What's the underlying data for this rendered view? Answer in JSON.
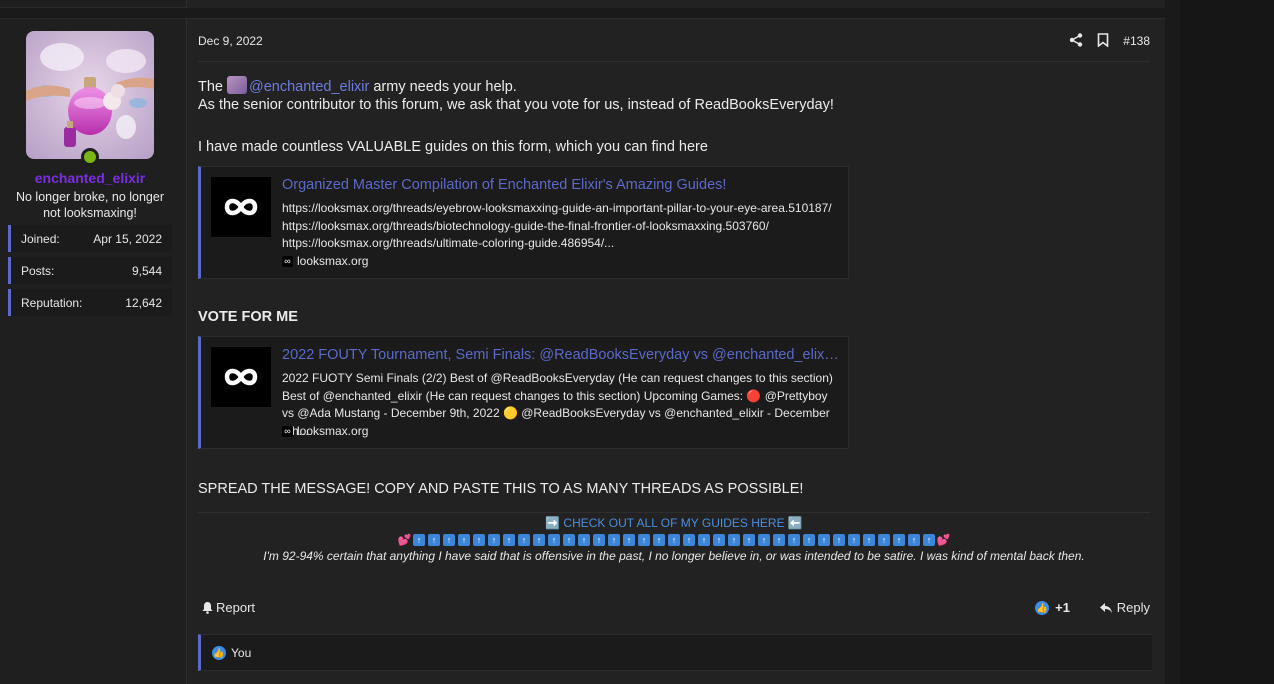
{
  "post": {
    "date": "Dec 9, 2022",
    "number": "#138",
    "author": {
      "username": "enchanted_elixir",
      "user_title": "No longer broke, no longer not looksmaxing!",
      "online": true,
      "stats": [
        {
          "label": "Joined:",
          "value": "Apr 15, 2022"
        },
        {
          "label": "Posts:",
          "value": "9,544"
        },
        {
          "label": "Reputation:",
          "value": "12,642"
        }
      ]
    },
    "lines": {
      "l1_pre": "The ",
      "l1_mention": "@enchanted_elixir",
      "l1_post": " army needs your help.",
      "l2": "As the senior contributor to this forum, we ask that you vote for us, instead of ReadBooksEveryday!",
      "l3": "I have made countless VALUABLE guides on this form, which you can find here",
      "vote": "VOTE FOR ME",
      "spread": "SPREAD THE MESSAGE! COPY AND PASTE THIS TO AS MANY THREADS AS POSSIBLE!"
    },
    "unfurls": [
      {
        "title": "Organized Master Compilation of Enchanted Elixir's Amazing Guides!",
        "description": "https://looksmax.org/threads/eyebrow-looksmaxxing-guide-an-important-pillar-to-your-eye-area.510187/ https://looksmax.org/threads/biotechnology-guide-the-final-frontier-of-looksmaxxing.503760/ https://looksmax.org/threads/ultimate-coloring-guide.486954/...",
        "site": "looksmax.org"
      },
      {
        "title": "2022 FOUTY Tournament, Semi Finals: @ReadBooksEveryday vs @enchanted_elixir...",
        "description": "2022 FUOTY Semi Finals (2/2) Best of @ReadBooksEveryday (He can request changes to this section) Best of @enchanted_elixir (He can request changes to this section) Upcoming Games: 🔴 @Prettyboy vs @Ada Mustang - December 9th, 2022 🟡 @ReadBooksEveryday vs @enchanted_elixir - December 9th...",
        "site": "looksmax.org"
      }
    ],
    "signature": {
      "link": "➡️ CHECK OUT ALL OF MY GUIDES HERE ⬅️",
      "note": "I'm 92-94% certain that anything I have said that is offensive in the past, I no longer believe in, or was intended to be satire. I was kind of mental back then."
    },
    "footer": {
      "report_label": "Report",
      "reaction_count": "+1",
      "reply_label": "Reply",
      "reacted_by": "You"
    }
  },
  "colors": {
    "accent": "#5b6ac8",
    "username": "#7a2fe0",
    "mention": "#6b7ee0",
    "online": "#7cb518",
    "like": "#3a8ee6"
  },
  "icons": [
    "share-icon",
    "bookmark-icon",
    "bell-icon",
    "like-icon",
    "reply-icon",
    "site-logo-icon",
    "up-arrow-icon",
    "heart-icon"
  ]
}
